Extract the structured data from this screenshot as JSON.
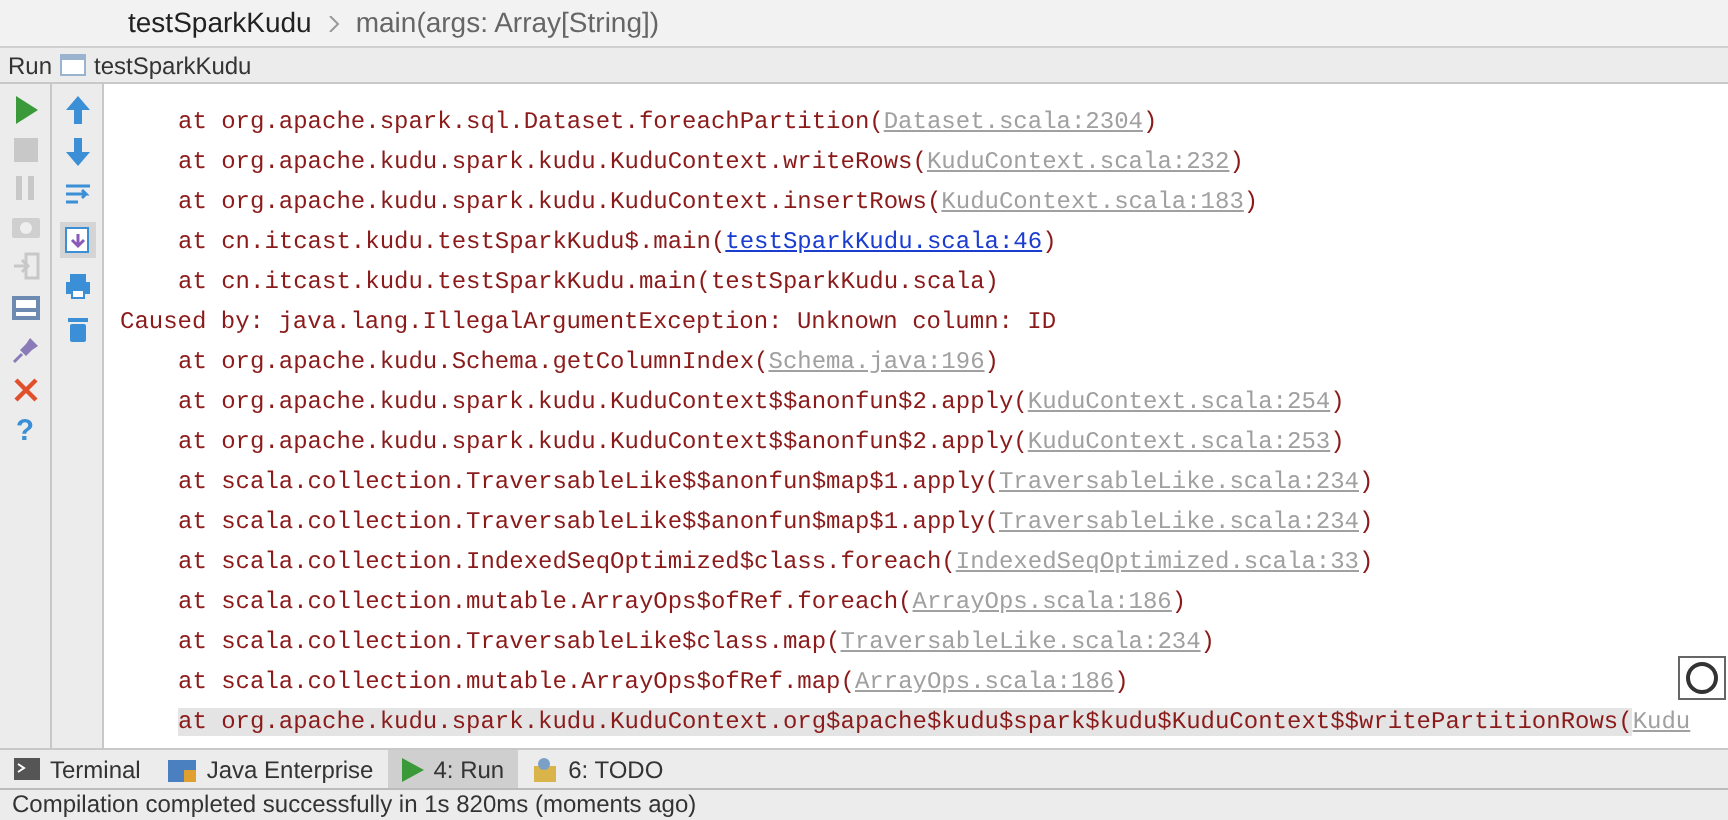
{
  "breadcrumb": [
    {
      "label": "testSparkKudu"
    },
    {
      "label": "main(args: Array[String])"
    }
  ],
  "run_bar": {
    "label": "Run",
    "config": "testSparkKudu"
  },
  "side_toolbar": {
    "help": "?"
  },
  "console": [
    {
      "kind": "frame",
      "text": "at org.apache.spark.sql.Dataset.foreachPartition(",
      "source": "Dataset.scala:2304",
      "in_project": false,
      "suffix": ")",
      "highlighted": false
    },
    {
      "kind": "frame",
      "text": "at org.apache.kudu.spark.kudu.KuduContext.writeRows(",
      "source": "KuduContext.scala:232",
      "in_project": false,
      "suffix": ")",
      "highlighted": false
    },
    {
      "kind": "frame",
      "text": "at org.apache.kudu.spark.kudu.KuduContext.insertRows(",
      "source": "KuduContext.scala:183",
      "in_project": false,
      "suffix": ")",
      "highlighted": false
    },
    {
      "kind": "frame",
      "text": "at cn.itcast.kudu.testSparkKudu$.main(",
      "source": "testSparkKudu.scala:46",
      "in_project": true,
      "suffix": ")",
      "highlighted": false
    },
    {
      "kind": "frame",
      "text": "at cn.itcast.kudu.testSparkKudu.main(testSparkKudu.scala)",
      "highlighted": false
    },
    {
      "kind": "cause",
      "text": "Caused by: java.lang.IllegalArgumentException: Unknown column: ID",
      "highlighted": false
    },
    {
      "kind": "frame",
      "text": "at org.apache.kudu.Schema.getColumnIndex(",
      "source": "Schema.java:196",
      "in_project": false,
      "suffix": ")",
      "highlighted": false
    },
    {
      "kind": "frame",
      "text": "at org.apache.kudu.spark.kudu.KuduContext$$anonfun$2.apply(",
      "source": "KuduContext.scala:254",
      "in_project": false,
      "suffix": ")",
      "highlighted": false
    },
    {
      "kind": "frame",
      "text": "at org.apache.kudu.spark.kudu.KuduContext$$anonfun$2.apply(",
      "source": "KuduContext.scala:253",
      "in_project": false,
      "suffix": ")",
      "highlighted": false
    },
    {
      "kind": "frame",
      "text": "at scala.collection.TraversableLike$$anonfun$map$1.apply(",
      "source": "TraversableLike.scala:234",
      "in_project": false,
      "suffix": ")",
      "highlighted": false
    },
    {
      "kind": "frame",
      "text": "at scala.collection.TraversableLike$$anonfun$map$1.apply(",
      "source": "TraversableLike.scala:234",
      "in_project": false,
      "suffix": ")",
      "highlighted": false
    },
    {
      "kind": "frame",
      "text": "at scala.collection.IndexedSeqOptimized$class.foreach(",
      "source": "IndexedSeqOptimized.scala:33",
      "in_project": false,
      "suffix": ")",
      "highlighted": false
    },
    {
      "kind": "frame",
      "text": "at scala.collection.mutable.ArrayOps$ofRef.foreach(",
      "source": "ArrayOps.scala:186",
      "in_project": false,
      "suffix": ")",
      "highlighted": false
    },
    {
      "kind": "frame",
      "text": "at scala.collection.TraversableLike$class.map(",
      "source": "TraversableLike.scala:234",
      "in_project": false,
      "suffix": ")",
      "highlighted": false
    },
    {
      "kind": "frame",
      "text": "at scala.collection.mutable.ArrayOps$ofRef.map(",
      "source": "ArrayOps.scala:186",
      "in_project": false,
      "suffix": ")",
      "highlighted": false
    },
    {
      "kind": "frame",
      "text": "at org.apache.kudu.spark.kudu.KuduContext.org$apache$kudu$spark$kudu$KuduContext$$writePartitionRows(",
      "source": "Kudu",
      "in_project": false,
      "highlighted": true
    }
  ],
  "tool_tabs": [
    {
      "label": "Terminal",
      "selected": false
    },
    {
      "label": "Java Enterprise",
      "selected": false
    },
    {
      "label": "4: Run",
      "selected": true
    },
    {
      "label": "6: TODO",
      "selected": false
    }
  ],
  "status_bar": "Compilation completed successfully in 1s 820ms (moments ago)"
}
